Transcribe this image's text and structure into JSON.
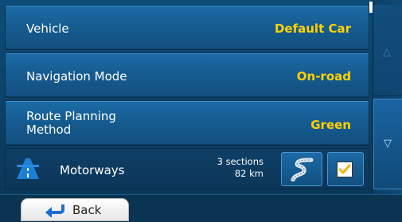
{
  "settings": [
    {
      "label": "Vehicle",
      "value": "Default Car"
    },
    {
      "label": "Navigation Mode",
      "value": "On-road"
    },
    {
      "label_line1": "Route Planning",
      "label_line2": "Method",
      "value": "Green"
    }
  ],
  "motorways": {
    "label": "Motorways",
    "sections": "3 sections",
    "distance": "82 km",
    "checked": true,
    "icon": "motorway-icon"
  },
  "back_label": "Back",
  "colors": {
    "value_yellow": "#ffd200",
    "row_blue": "#1c6ca7",
    "background": "#0b3a5e"
  }
}
